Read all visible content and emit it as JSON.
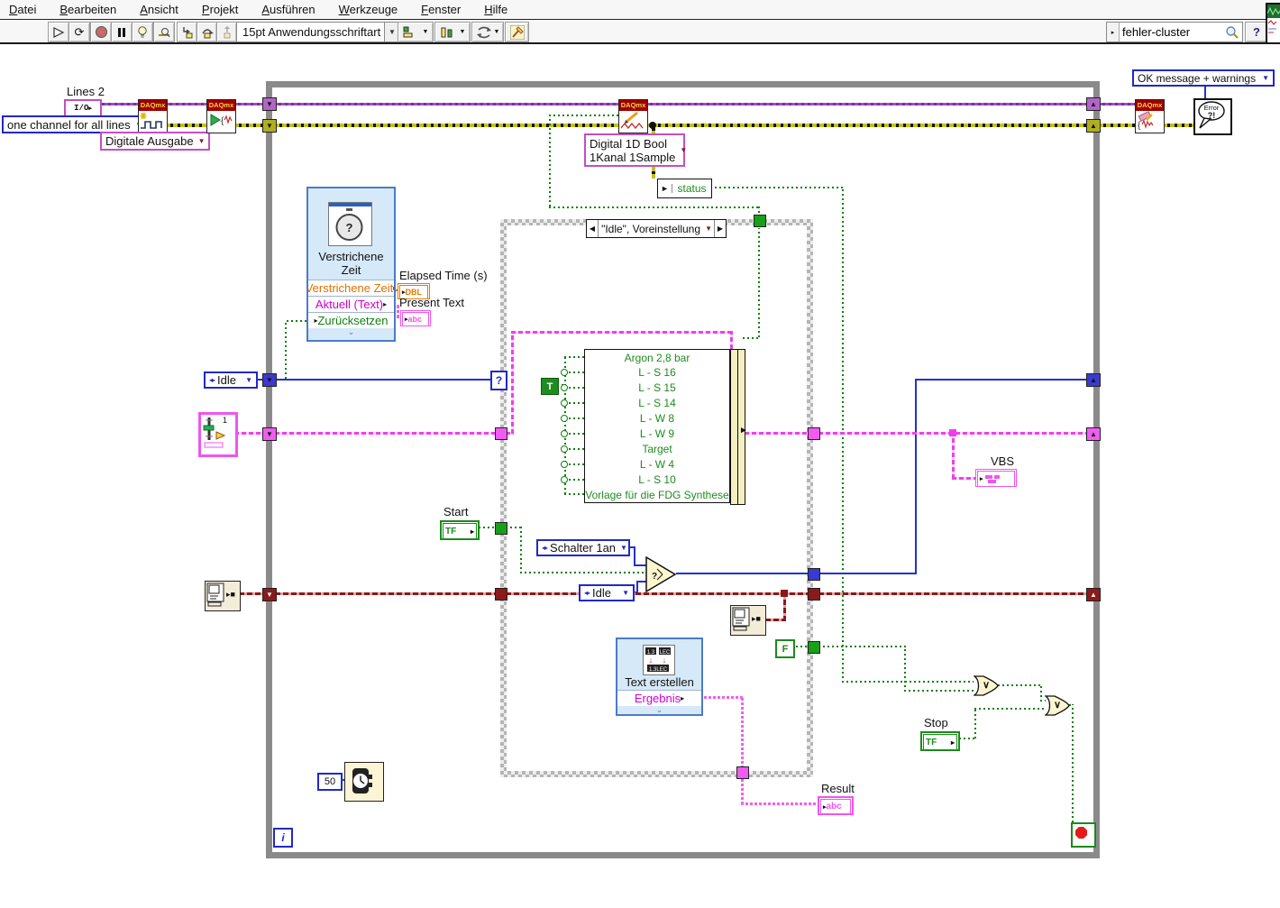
{
  "window": {
    "menu_items": [
      "Datei",
      "Bearbeiten",
      "Ansicht",
      "Projekt",
      "Ausführen",
      "Werkzeuge",
      "Fenster",
      "Hilfe"
    ]
  },
  "toolbar": {
    "font_selector": "15pt Anwendungsschriftart",
    "search_value": "fehler-cluster",
    "help_label": "?"
  },
  "diagram": {
    "daqmx_label": "DAQmx",
    "daq_setup": {
      "lines_label": "Lines 2",
      "io_constant": "I/O",
      "channel_mode": "one channel for all lines",
      "channel_type": "Digitale Ausgabe"
    },
    "write": {
      "selector_line1": "Digital 1D Bool",
      "selector_line2": "1Kanal 1Sample",
      "status_label": "status"
    },
    "case_structure": {
      "header": "\"Idle\", Voreinstellung",
      "selector_glyph": "?"
    },
    "elapsed_vi": {
      "title_line1": "Verstrichene",
      "title_line2": "Zeit",
      "row_elapsed": "Verstrichene Zeit",
      "row_present": "Aktuell (Text)",
      "row_reset": "Zurücksetzen",
      "out_elapsed_label": "Elapsed Time (s)",
      "out_present_label": "Present Text",
      "dbl": "DBL",
      "abc": "abc"
    },
    "state_enum": "Idle",
    "bundle": {
      "rows": [
        "Argon 2,8 bar",
        "L - S 16",
        "L - S 15",
        "L - S 14",
        "L - W 8",
        "L - W 9",
        "Target",
        "L - W 4",
        "L - S 10",
        "Vorlage für die FDG Synthese"
      ],
      "true_const": "T"
    },
    "select_node": {
      "input_top": "Schalter 1an",
      "input_bottom": "Idle"
    },
    "start": {
      "label": "Start",
      "tf": "TF"
    },
    "stop": {
      "label": "Stop",
      "tf": "TF"
    },
    "false_const": "F",
    "build_text_vi": {
      "title": "Text erstellen",
      "output_row": "Ergebnis"
    },
    "result": {
      "label": "Result",
      "abc": "abc"
    },
    "vbs": {
      "label": "VBS"
    },
    "wait": {
      "ms": "50"
    },
    "iteration_terminal": "i",
    "or_symbol": "∨",
    "error_output": {
      "mode": "OK message + warnings",
      "bubble_top": "Error",
      "bubble_bottom": "?!"
    }
  }
}
